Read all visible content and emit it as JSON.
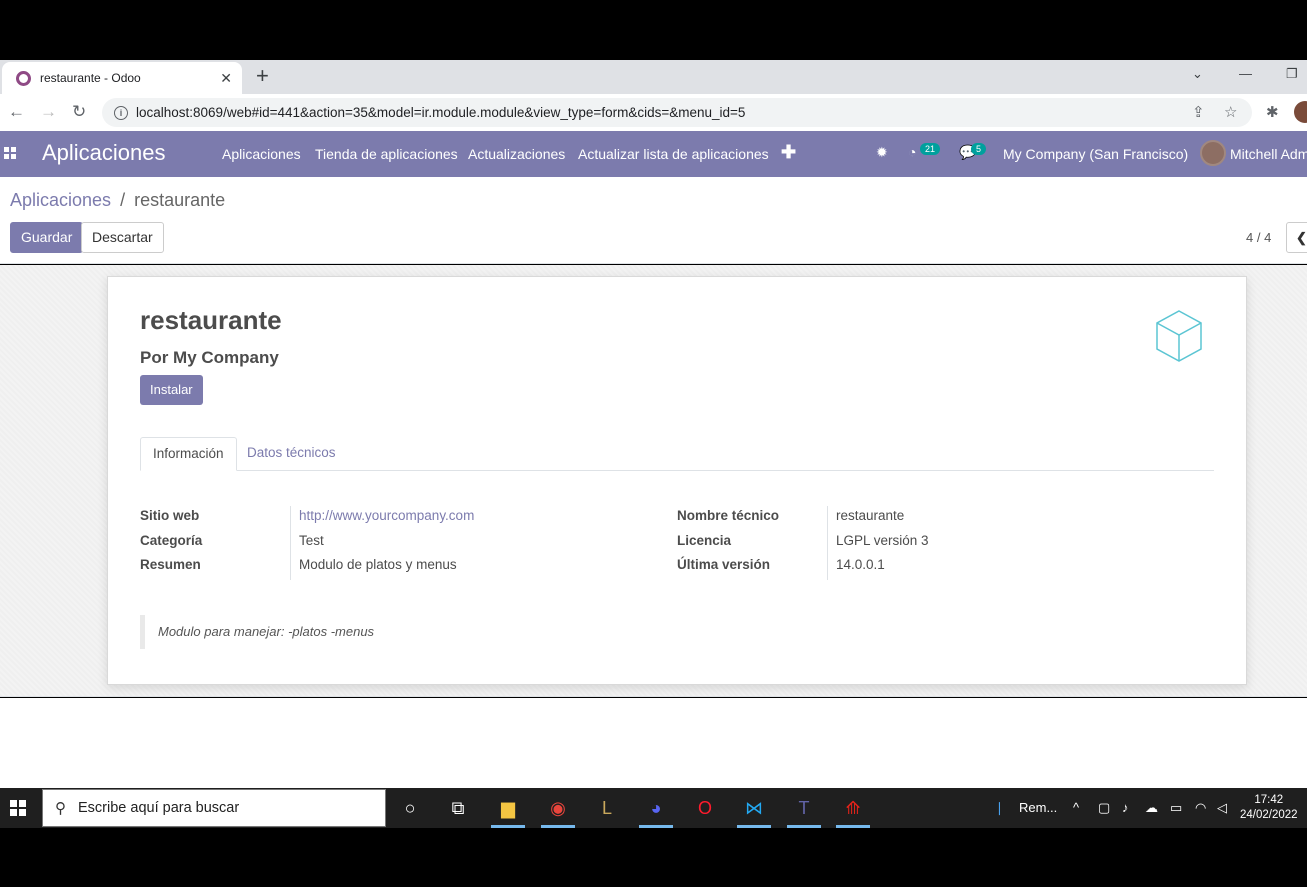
{
  "browser": {
    "tab_title": "restaurante - Odoo",
    "url": "localhost:8069/web#id=441&action=35&model=ir.module.module&view_type=form&cids=&menu_id=5"
  },
  "navbar": {
    "brand": "Aplicaciones",
    "menu": [
      "Aplicaciones",
      "Tienda de aplicaciones",
      "Actualizaciones",
      "Actualizar lista de aplicaciones"
    ],
    "activity_count": "21",
    "message_count": "5",
    "company": "My Company (San Francisco)",
    "user": "Mitchell Admin"
  },
  "breadcrumb": {
    "parent": "Aplicaciones",
    "separator": "/",
    "current": "restaurante"
  },
  "toolbar": {
    "save_label": "Guardar",
    "discard_label": "Descartar",
    "pager": "4 / 4"
  },
  "record": {
    "title": "restaurante",
    "author": "Por My Company",
    "install_label": "Instalar",
    "tabs": [
      "Información",
      "Datos técnicos"
    ],
    "left_fields": [
      {
        "label": "Sitio web",
        "value": "http://www.yourcompany.com"
      },
      {
        "label": "Categoría",
        "value": "Test"
      },
      {
        "label": "Resumen",
        "value": "Modulo de platos y menus"
      }
    ],
    "right_fields": [
      {
        "label": "Nombre técnico",
        "value": "restaurante"
      },
      {
        "label": "Licencia",
        "value": "LGPL versión 3"
      },
      {
        "label": "Última versión",
        "value": "14.0.0.1"
      }
    ],
    "description": "Modulo para manejar: -platos -menus"
  },
  "taskbar": {
    "search_placeholder": "Escribe aquí para buscar",
    "tray_app": "Rem...",
    "time": "17:42",
    "date": "24/02/2022"
  },
  "colors": {
    "odoo_primary": "#7c7bad",
    "badge": "#00a09d"
  }
}
